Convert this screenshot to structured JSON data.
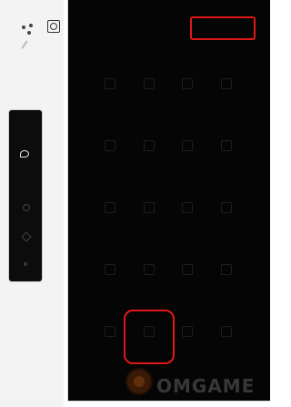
{
  "panel": {
    "title": "",
    "done_label": "",
    "sections": [
      {
        "label": "",
        "tiles": [
          {
            "caption": ""
          },
          {
            "caption": ""
          },
          {
            "caption": ""
          },
          {
            "caption": ""
          }
        ]
      },
      {
        "label": "",
        "tiles": [
          {
            "caption": ""
          },
          {
            "caption": ""
          },
          {
            "caption": ""
          },
          {
            "caption": ""
          }
        ]
      },
      {
        "label": "",
        "tiles": [
          {
            "caption": ""
          },
          {
            "caption": ""
          },
          {
            "caption": ""
          },
          {
            "caption": ""
          }
        ]
      },
      {
        "label": "",
        "tiles": [
          {
            "caption": ""
          },
          {
            "caption": ""
          },
          {
            "caption": ""
          },
          {
            "caption": ""
          }
        ]
      },
      {
        "label": "",
        "tiles": [
          {
            "caption": ""
          },
          {
            "caption": ""
          },
          {
            "caption": ""
          },
          {
            "caption": ""
          }
        ]
      }
    ]
  },
  "highlight_color": "#e01818",
  "watermark": {
    "text": "OMGAME"
  }
}
